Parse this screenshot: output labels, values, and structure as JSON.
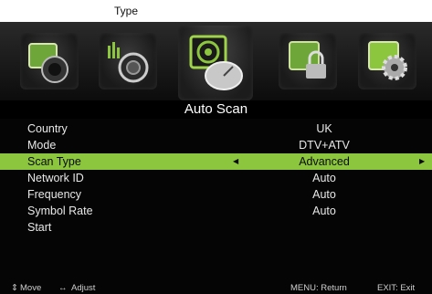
{
  "top_caption": "Type",
  "icons": [
    "picture-icon",
    "sound-icon",
    "channel-icon",
    "lock-icon",
    "setup-icon"
  ],
  "title": "Auto Scan",
  "rows": [
    {
      "label": "Country",
      "value": "UK"
    },
    {
      "label": "Mode",
      "value": "DTV+ATV"
    },
    {
      "label": "Scan Type",
      "value": "Advanced",
      "selected": true
    },
    {
      "label": "Network ID",
      "value": "Auto"
    },
    {
      "label": "Frequency",
      "value": "Auto"
    },
    {
      "label": "Symbol Rate",
      "value": "Auto"
    },
    {
      "label": "Start",
      "value": ""
    }
  ],
  "footer": {
    "move": "Move",
    "adjust": "Adjust",
    "menu": "MENU: Return",
    "exit": "EXIT: Exit"
  },
  "colors": {
    "highlight": "#8cc63e",
    "background": "#050505"
  }
}
